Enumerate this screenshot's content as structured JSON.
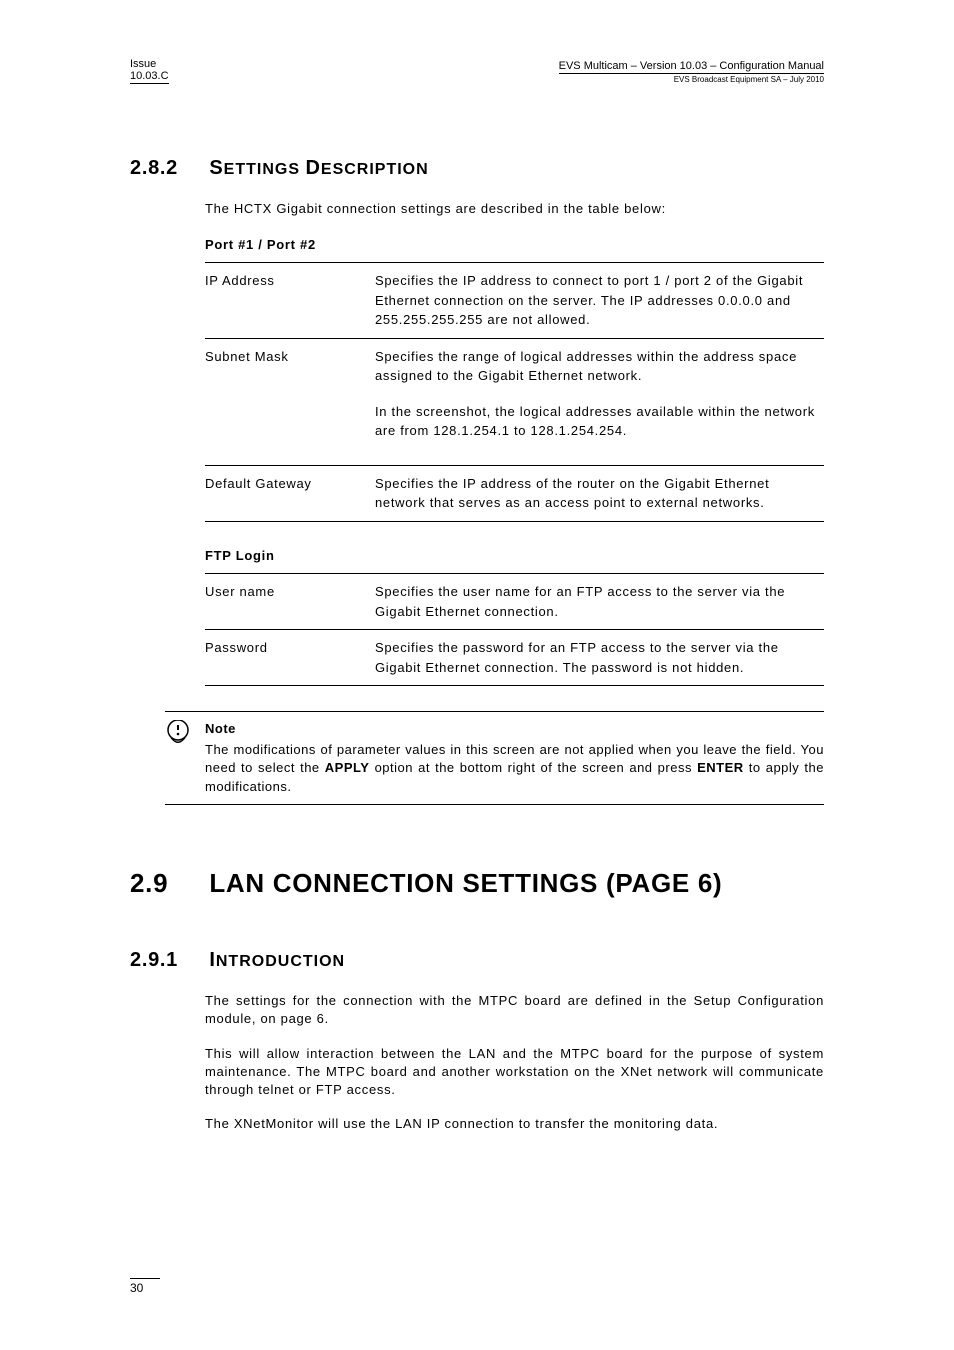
{
  "header": {
    "left_line1": "Issue",
    "left_line2": "10.03.C",
    "right_line1": "EVS Multicam  – Version 10.03 – Configuration Manual",
    "right_line2": "EVS Broadcast Equipment SA – July 2010"
  },
  "section_2_8_2": {
    "number": "2.8.2",
    "title_main": "S",
    "title_rest": "ETTINGS ",
    "title_main2": "D",
    "title_rest2": "ESCRIPTION",
    "intro": "The HCTX Gigabit connection settings are described in the table below:",
    "table1_heading": "Port #1 / Port #2",
    "table1": [
      {
        "name": "IP Address",
        "desc": "Specifies the IP address to connect to port 1 / port 2 of the Gigabit Ethernet connection on the server. The IP addresses 0.0.0.0 and 255.255.255.255 are not allowed."
      },
      {
        "name": "Subnet Mask",
        "desc1": "Specifies the range of logical addresses within the address space assigned to the Gigabit Ethernet network.",
        "desc2": "In the screenshot, the logical addresses available within the network are from 128.1.254.1 to 128.1.254.254."
      },
      {
        "name": "Default Gateway",
        "desc": "Specifies the IP address of the router on the Gigabit Ethernet network that serves as an access point to external networks."
      }
    ],
    "table2_heading": "FTP Login",
    "table2": [
      {
        "name": "User name",
        "desc": "Specifies the user name for an FTP access to the server via the Gigabit Ethernet connection."
      },
      {
        "name": "Password",
        "desc": "Specifies the password for an FTP access to the server via the Gigabit Ethernet connection. The password is not hidden."
      }
    ],
    "note": {
      "label": "Note",
      "text_before": "The modifications of parameter values in this screen are not applied when you leave the field. You need to select the ",
      "apply": "APPLY",
      "text_mid": " option at the bottom right of the screen and press ",
      "enter": "ENTER",
      "text_after": " to apply the modifications."
    }
  },
  "section_2_9": {
    "number": "2.9",
    "title": "LAN CONNECTION SETTINGS (PAGE 6)"
  },
  "section_2_9_1": {
    "number": "2.9.1",
    "title_main": "I",
    "title_rest": "NTRODUCTION",
    "p1": "The settings for the connection with the MTPC board are defined in the Setup Configuration module, on page 6.",
    "p2": "This will allow interaction between the LAN and the MTPC board for the purpose of system maintenance. The MTPC board and another workstation on the XNet network will communicate through telnet or FTP access.",
    "p3": "The XNetMonitor will use the LAN IP connection to transfer the monitoring data."
  },
  "page_number": "30"
}
